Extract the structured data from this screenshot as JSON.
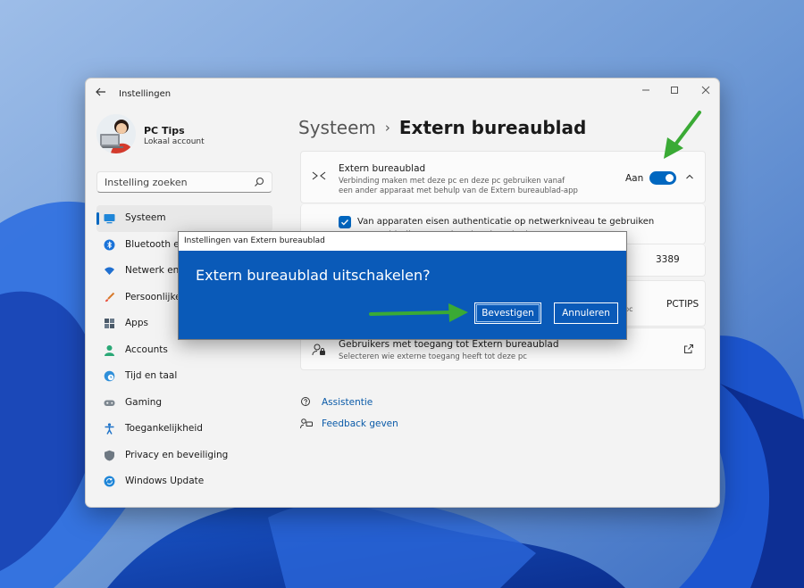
{
  "window": {
    "app_title": "Instellingen",
    "controls": {
      "minimize": "—",
      "maximize": "▢",
      "close": "✕"
    }
  },
  "profile": {
    "name": "PC Tips",
    "account_type": "Lokaal account"
  },
  "search": {
    "placeholder": "Instelling zoeken"
  },
  "sidebar": {
    "items": [
      {
        "label": "Systeem",
        "icon": "monitor-icon",
        "active": true
      },
      {
        "label": "Bluetooth en apparaten",
        "icon": "bluetooth-icon"
      },
      {
        "label": "Netwerk en internet",
        "icon": "wifi-icon"
      },
      {
        "label": "Persoonlijke instellingen",
        "icon": "brush-icon"
      },
      {
        "label": "Apps",
        "icon": "apps-icon"
      },
      {
        "label": "Accounts",
        "icon": "person-icon"
      },
      {
        "label": "Tijd en taal",
        "icon": "globe-clock-icon"
      },
      {
        "label": "Gaming",
        "icon": "gamepad-icon"
      },
      {
        "label": "Toegankelijkheid",
        "icon": "accessibility-icon"
      },
      {
        "label": "Privacy en beveiliging",
        "icon": "shield-icon"
      },
      {
        "label": "Windows Update",
        "icon": "update-icon"
      }
    ]
  },
  "breadcrumb": {
    "parent": "Systeem",
    "separator": "›",
    "current": "Extern bureaublad"
  },
  "remote_desktop": {
    "title": "Extern bureaublad",
    "description_line1": "Verbinding maken met deze pc en deze pc gebruiken vanaf",
    "description_line2": "een ander apparaat met behulp van de Extern bureaublad-app",
    "toggle_label": "Aan",
    "toggle_on": true
  },
  "nla": {
    "checked": true,
    "text": "Van apparaten eisen authenticatie op netwerkniveau te gebruiken om verbinding te maken (aanbevolen)"
  },
  "port_value": "3389",
  "pc_name_value": "PCTIPS",
  "pc_name_partial": "pc",
  "users": {
    "title": "Gebruikers met toegang tot Extern bureaublad",
    "description": "Selecteren wie externe toegang heeft tot deze pc"
  },
  "links": {
    "help": "Assistentie",
    "feedback": "Feedback geven"
  },
  "dialog": {
    "title": "Instellingen van Extern bureaublad",
    "message": "Extern bureaublad uitschakelen?",
    "confirm": "Bevestigen",
    "cancel": "Annuleren"
  },
  "colors": {
    "accent": "#0067c0",
    "dialog_bg": "#0a5ab8",
    "annotation_arrow": "#3aaa35",
    "window_bg": "#f3f3f3"
  }
}
